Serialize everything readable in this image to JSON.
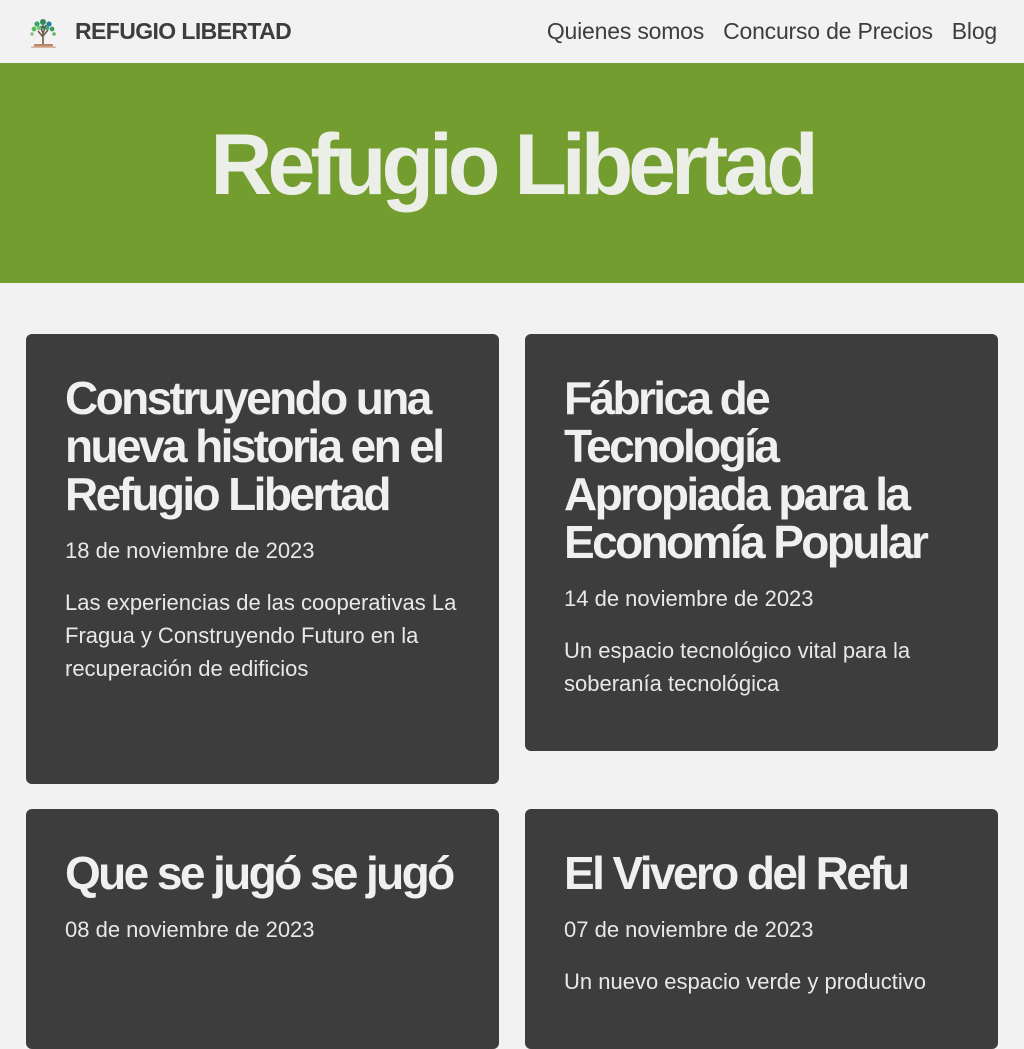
{
  "header": {
    "brand_name": "REFUGIO LIBERTAD",
    "logo_icon": "tree-logo-icon",
    "nav": [
      {
        "label": "Quienes somos"
      },
      {
        "label": "Concurso de Precios"
      },
      {
        "label": "Blog"
      }
    ]
  },
  "hero": {
    "title": "Refugio Libertad"
  },
  "posts": [
    {
      "title": "Construyendo una nueva historia en el Refugio Libertad",
      "date": "18 de noviembre de 2023",
      "excerpt": "Las experiencias de las cooperativas La Fragua y Construyendo Futuro en la recuperación de edificios"
    },
    {
      "title": "Fábrica de Tecnología Apropiada para la Economía Popular",
      "date": "14 de noviembre de 2023",
      "excerpt": "Un espacio tecnológico vital para la soberanía tecnológica"
    },
    {
      "title": "Que se jugó se jugó",
      "date": "08 de noviembre de 2023",
      "excerpt": ""
    },
    {
      "title": "El Vivero del Refu",
      "date": "07 de noviembre de 2023",
      "excerpt": "Un nuevo espacio verde y productivo"
    }
  ],
  "colors": {
    "page_background": "#f2f2f2",
    "hero_background": "#739e2f",
    "card_background": "#3d3d3d",
    "text_dark": "#3d3d3d",
    "text_light": "#f0f0f0"
  }
}
